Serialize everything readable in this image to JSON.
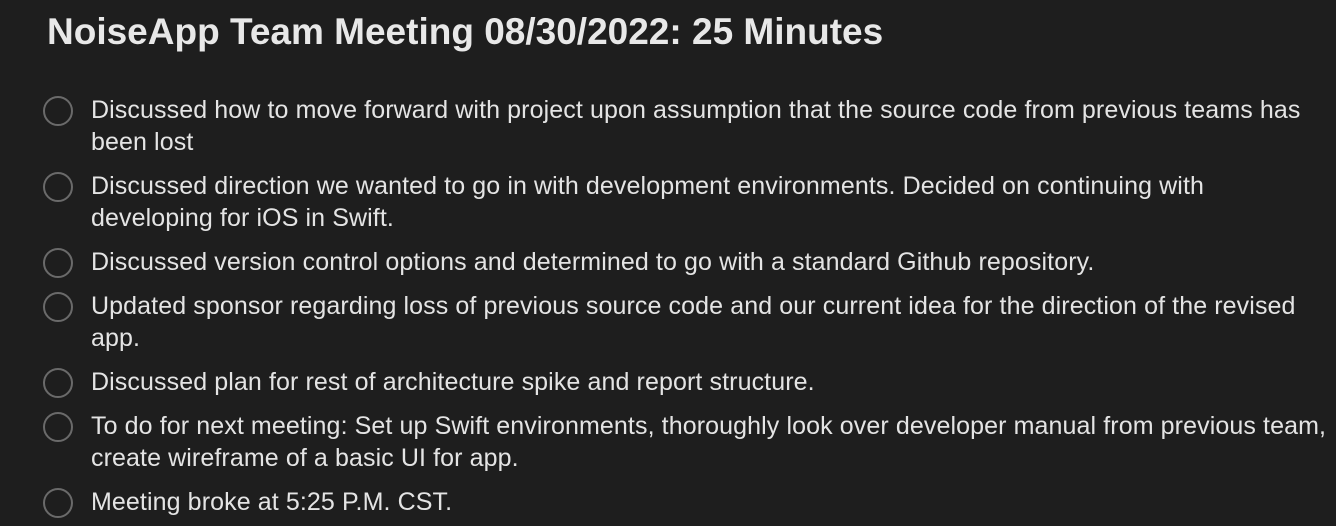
{
  "note": {
    "title": "NoiseApp Team Meeting 08/30/2022: 25 Minutes",
    "items": [
      {
        "text": "Discussed how to move forward with project upon assumption that the source code from previous teams has been lost",
        "checked": false
      },
      {
        "text": "Discussed direction we wanted to go in with development environments. Decided on continuing with developing for iOS in Swift.",
        "checked": false
      },
      {
        "text": "Discussed version control options and determined to go with a standard Github repository.",
        "checked": false
      },
      {
        "text": "Updated sponsor regarding loss of previous source code and our current idea for the direction of the revised app.",
        "checked": false
      },
      {
        "text": "Discussed plan for rest of architecture spike and report structure.",
        "checked": false
      },
      {
        "text": "To do for next meeting: Set up Swift environments, thoroughly look over developer manual from previous team, create wireframe of a basic UI for app.",
        "checked": false
      },
      {
        "text": "Meeting broke at 5:25 P.M. CST.",
        "checked": false
      }
    ]
  },
  "colors": {
    "background": "#1e1e1e",
    "text": "#e4e4e4",
    "checkbox_border": "#6a6a6a"
  }
}
